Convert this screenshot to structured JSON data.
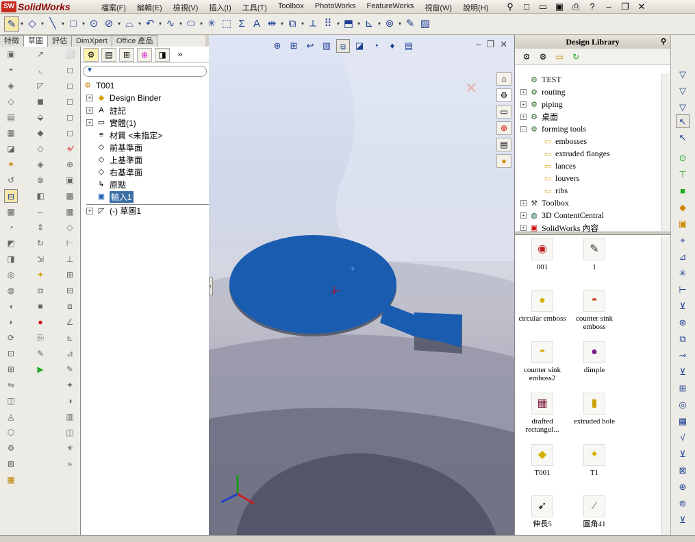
{
  "app": {
    "name": "SolidWorks",
    "logo": "SW"
  },
  "menu": [
    "檔案(F)",
    "編輯(E)",
    "檢視(V)",
    "插入(I)",
    "工具(T)",
    "Toolbox",
    "PhotoWorks",
    "FeatureWorks",
    "視窗(W)",
    "說明(H)"
  ],
  "tabs": [
    "特徵",
    "草圖",
    "評估",
    "DimXpert",
    "Office 產品"
  ],
  "tree": {
    "root": "T001",
    "filter_icon": "filter-icon",
    "nodes": [
      {
        "label": "Design Binder",
        "exp": "+"
      },
      {
        "label": "註記",
        "exp": "+"
      },
      {
        "label": "實體(1)",
        "exp": "+"
      },
      {
        "label": "材質 <未指定>",
        "exp": ""
      },
      {
        "label": "前基準面",
        "exp": ""
      },
      {
        "label": "上基準面",
        "exp": ""
      },
      {
        "label": "右基準面",
        "exp": ""
      },
      {
        "label": "原點",
        "exp": ""
      },
      {
        "label": "輸入1",
        "exp": ""
      },
      {
        "label": "(-) 草圖1",
        "exp": "+"
      }
    ]
  },
  "library": {
    "title": "Design Library",
    "tree": [
      {
        "label": "TEST",
        "exp": "",
        "indent": 0
      },
      {
        "label": "routing",
        "exp": "+",
        "indent": 0
      },
      {
        "label": "piping",
        "exp": "+",
        "indent": 0
      },
      {
        "label": "桌面",
        "exp": "+",
        "indent": 0
      },
      {
        "label": "forming tools",
        "exp": "−",
        "indent": 0
      },
      {
        "label": "embosses",
        "exp": "",
        "indent": 1
      },
      {
        "label": "extruded flanges",
        "exp": "",
        "indent": 1
      },
      {
        "label": "lances",
        "exp": "",
        "indent": 1
      },
      {
        "label": "louvers",
        "exp": "",
        "indent": 1
      },
      {
        "label": "ribs",
        "exp": "",
        "indent": 1
      },
      {
        "label": "Toolbox",
        "exp": "+",
        "indent": 0
      },
      {
        "label": "3D ContentCentral",
        "exp": "+",
        "indent": 0
      },
      {
        "label": "SolidWorks 內容",
        "exp": "+",
        "indent": 0
      }
    ],
    "items": [
      {
        "label": "001"
      },
      {
        "label": "1"
      },
      {
        "label": "circular emboss"
      },
      {
        "label": "counter sink emboss"
      },
      {
        "label": "counter sink emboss2"
      },
      {
        "label": "dimple"
      },
      {
        "label": "drafted rectangul..."
      },
      {
        "label": "extruded hole"
      },
      {
        "label": "T001"
      },
      {
        "label": "T1"
      },
      {
        "label": "伸長5"
      },
      {
        "label": "圓角41"
      }
    ]
  },
  "colors": {
    "part_blue": "#1a5cb0",
    "part_shadow": "#5c6070",
    "accent": "#3a6ea5"
  }
}
